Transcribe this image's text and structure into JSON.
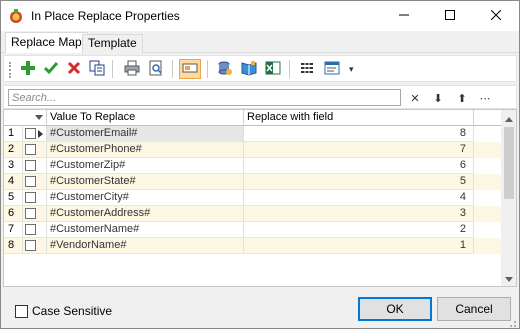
{
  "window": {
    "title": "In Place Replace Properties",
    "controls": {
      "minimize": "minimize-icon",
      "maximize": "maximize-icon",
      "close": "close-icon"
    }
  },
  "tabs": [
    {
      "label": "Replace Map",
      "active": true
    },
    {
      "label": "Template",
      "active": false
    }
  ],
  "toolbar": {
    "buttons": [
      "add-icon",
      "accept-icon",
      "delete-icon",
      "copy-icon",
      "print-icon",
      "print-preview-icon",
      "column-chooser-icon",
      "database-icon",
      "open-book-icon",
      "excel-export-icon",
      "columns-icon",
      "layout-icon"
    ],
    "pressed": "column-chooser-icon",
    "overflow_glyph": "▾"
  },
  "search": {
    "placeholder": "Search...",
    "value": "",
    "buttons": {
      "clear": "✕",
      "down": "⬇",
      "up": "⬆",
      "more": "⋯"
    }
  },
  "grid": {
    "columns": [
      "Value To Replace",
      "Replace with field"
    ],
    "rows": [
      {
        "num": "1",
        "value": "#CustomerEmail#",
        "field": "8",
        "selected": true
      },
      {
        "num": "2",
        "value": "#CustomerPhone#",
        "field": "7"
      },
      {
        "num": "3",
        "value": "#CustomerZip#",
        "field": "6"
      },
      {
        "num": "4",
        "value": "#CustomerState#",
        "field": "5"
      },
      {
        "num": "5",
        "value": "#CustomerCity#",
        "field": "4"
      },
      {
        "num": "6",
        "value": "#CustomerAddress#",
        "field": "3"
      },
      {
        "num": "7",
        "value": "#CustomerName#",
        "field": "2"
      },
      {
        "num": "8",
        "value": "#VendorName#",
        "field": "1"
      }
    ]
  },
  "footer": {
    "case_sensitive_label": "Case Sensitive",
    "case_sensitive_checked": false,
    "ok_label": "OK",
    "cancel_label": "Cancel"
  },
  "colors": {
    "row_alt": "#fdf6e3",
    "pressed_bg": "#ffd9a3",
    "accent": "#0078d7"
  }
}
